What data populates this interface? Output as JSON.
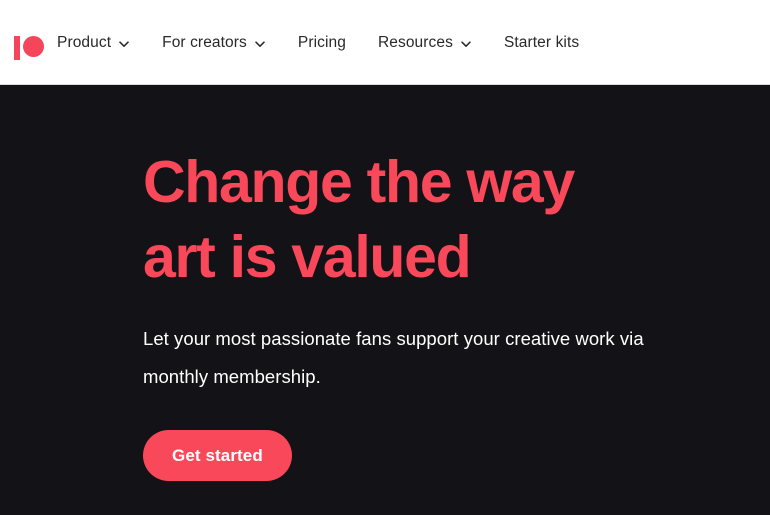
{
  "colors": {
    "brand_red": "#f9485a",
    "hero_background": "#131317",
    "header_background": "#ffffff",
    "nav_text": "#292929",
    "hero_text": "#ffffff"
  },
  "header": {
    "logo_name": "patreon-logo",
    "logo_alt": "Patreon",
    "nav": [
      {
        "label": "Product",
        "has_dropdown": true,
        "icon": "chevron-down-icon"
      },
      {
        "label": "For creators",
        "has_dropdown": true,
        "icon": "chevron-down-icon"
      },
      {
        "label": "Pricing",
        "has_dropdown": false,
        "icon": ""
      },
      {
        "label": "Resources",
        "has_dropdown": true,
        "icon": "chevron-down-icon"
      },
      {
        "label": "Starter kits",
        "has_dropdown": false,
        "icon": ""
      }
    ]
  },
  "hero": {
    "headline": "Change the way\nart is valued",
    "subtext": "Let your most passionate fans support your creative work via monthly membership.",
    "cta_label": "Get started"
  }
}
